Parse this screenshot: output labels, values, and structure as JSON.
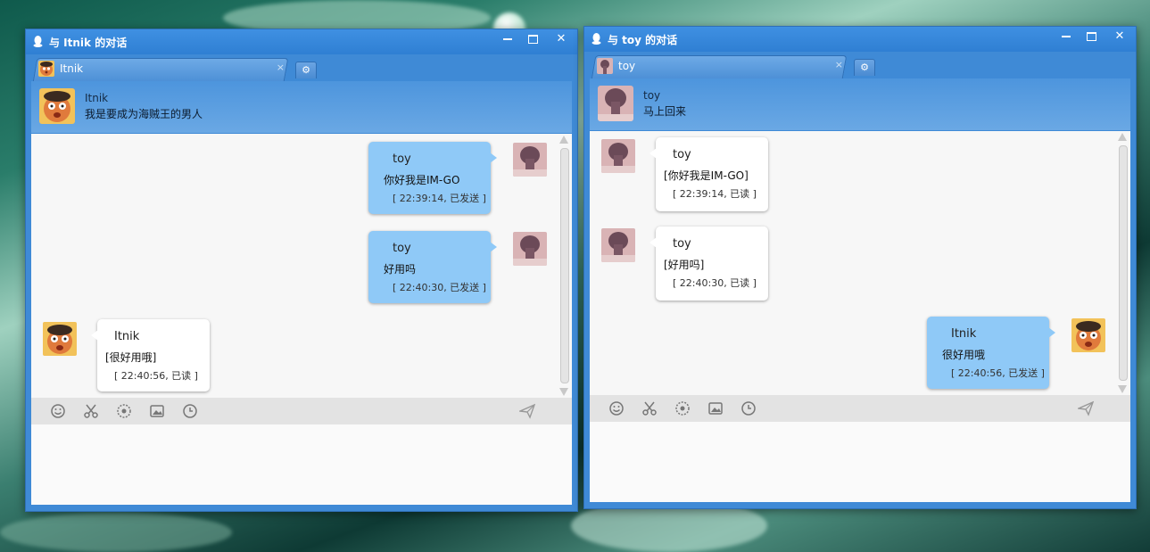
{
  "windows": [
    {
      "title": "与 Itnik 的对话",
      "tab_label": "Itnik",
      "contact": {
        "name": "Itnik",
        "status": "我是要成为海贼王的男人"
      },
      "messages": [
        {
          "side": "mine",
          "name": "toy",
          "text": "你好我是IM-GO",
          "time": "[ 22:39:14, 已发送 ]"
        },
        {
          "side": "mine",
          "name": "toy",
          "text": "好用吗",
          "time": "[ 22:40:30, 已发送 ]"
        },
        {
          "side": "theirs",
          "name": "Itnik",
          "text": "[很好用哦]",
          "time": "[ 22:40:56, 已读 ]"
        }
      ]
    },
    {
      "title": "与 toy 的对话",
      "tab_label": "toy",
      "contact": {
        "name": "toy",
        "status": "马上回来"
      },
      "messages": [
        {
          "side": "theirs",
          "name": "toy",
          "text": "[你好我是IM-GO]",
          "time": "[ 22:39:14, 已读 ]"
        },
        {
          "side": "theirs",
          "name": "toy",
          "text": "[好用吗]",
          "time": "[ 22:40:30, 已读 ]"
        },
        {
          "side": "mine",
          "name": "Itnik",
          "text": "很好用哦",
          "time": "[ 22:40:56, 已发送 ]"
        }
      ]
    }
  ],
  "tab_close_glyph": "×",
  "close_glyph": "✕",
  "toolbar_icons": [
    "smiley-icon",
    "scissors-icon",
    "screenshot-icon",
    "image-icon",
    "history-clock-icon"
  ],
  "send_icon": "send-paper-plane-icon",
  "colors": {
    "title_blue": "#2f7fd3",
    "my_bubble": "#8fc9f7",
    "their_bubble": "#ffffff"
  }
}
